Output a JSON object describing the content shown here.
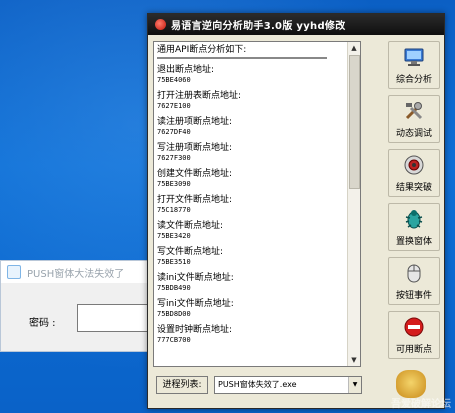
{
  "background_window": {
    "title": "PUSH窗体大法失效了",
    "password_label": "密码 :"
  },
  "main": {
    "title": "易语言逆向分析助手3.0版   yyhd修改",
    "list_header": "通用API断点分析如下:",
    "entries": [
      {
        "name": "退出断点地址:",
        "addr": "75BE4060"
      },
      {
        "name": "打开注册表断点地址:",
        "addr": "7627E100"
      },
      {
        "name": "读注册项断点地址:",
        "addr": "7627DF40"
      },
      {
        "name": "写注册项断点地址:",
        "addr": "7627F300"
      },
      {
        "name": "创建文件断点地址:",
        "addr": "75BE3090"
      },
      {
        "name": "打开文件断点地址:",
        "addr": "75C18770"
      },
      {
        "name": "读文件断点地址:",
        "addr": "75BE3420"
      },
      {
        "name": "写文件断点地址:",
        "addr": "75BE3510"
      },
      {
        "name": "读ini文件断点地址:",
        "addr": "75BDB490"
      },
      {
        "name": "写ini文件断点地址:",
        "addr": "75BD8D00"
      },
      {
        "name": "设置时钟断点地址:",
        "addr": "777CB700"
      }
    ],
    "side_buttons": [
      {
        "label": "综合分析",
        "icon": "monitor-icon"
      },
      {
        "label": "动态调试",
        "icon": "tools-icon"
      },
      {
        "label": "结果突破",
        "icon": "speaker-icon"
      },
      {
        "label": "置换窗体",
        "icon": "bug-icon"
      },
      {
        "label": "按钮事件",
        "icon": "mouse-icon"
      },
      {
        "label": "可用断点",
        "icon": "stop-icon"
      }
    ],
    "process_button": "进程列表:",
    "process_value": "PUSH窗体失效了.exe"
  },
  "watermark": "吾爱破解论坛"
}
